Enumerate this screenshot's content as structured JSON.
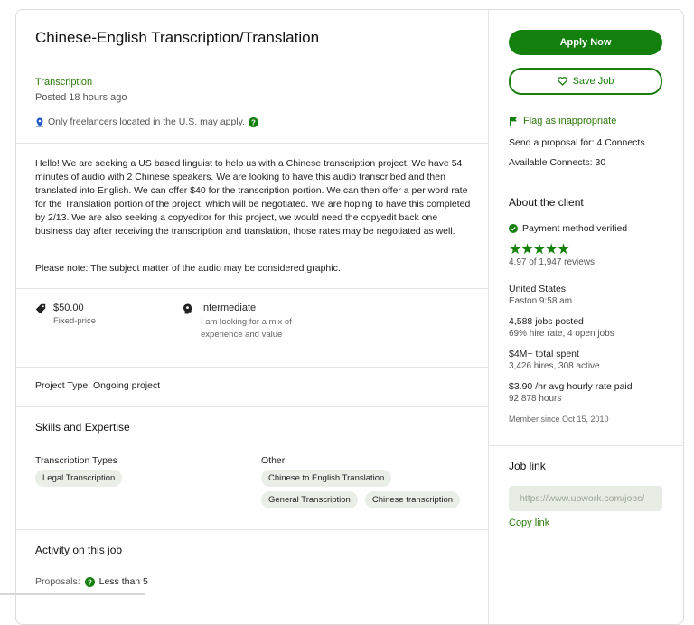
{
  "job": {
    "title": "Chinese-English Transcription/Translation",
    "category": "Transcription",
    "posted": "Posted 18 hours ago",
    "location_note": "Only freelancers located in the U.S. may apply.",
    "description": "Hello! We are seeking a US based linguist to help us with a Chinese transcription project. We have 54 minutes of audio with 2 Chinese speakers. We are looking to have this audio transcribed and then translated into English.  We can offer $40 for the transcription portion. We can then offer a per word rate for the Translation portion of the project, which will be negotiated. We are hoping to have this completed by 2/13.  We are also seeking a copyeditor for this project, we would need the copyedit back one business day after receiving the transcription and translation, those rates may be negotiated as well.",
    "note": "Please note: The subject matter of the audio may be considered graphic.",
    "price": "$50.00",
    "price_type": "Fixed-price",
    "level": "Intermediate",
    "level_desc_1": "I am looking for a mix of",
    "level_desc_2": "experience and value",
    "project_type_label": "Project Type:",
    "project_type": "Ongoing project"
  },
  "skills": {
    "heading": "Skills and Expertise",
    "group1_title": "Transcription Types",
    "group1": [
      "Legal Transcription"
    ],
    "group2_title": "Other",
    "group2": [
      "Chinese to English Translation",
      "General Transcription",
      "Chinese transcription"
    ]
  },
  "activity": {
    "heading": "Activity on this job",
    "proposals_label": "Proposals:",
    "proposals_value": "Less than 5"
  },
  "sidebar": {
    "apply_label": "Apply Now",
    "save_label": "Save Job",
    "flag_label": "Flag as inappropriate",
    "connects_send": "Send a proposal for: 4 Connects",
    "connects_available": "Available Connects: 30"
  },
  "client": {
    "heading": "About the client",
    "payment": "Payment method verified",
    "rating": 4.97,
    "stars": "★★★★★",
    "reviews": "4.97 of 1,947 reviews",
    "country": "United States",
    "local_time": "Easton 9:58 am",
    "jobs_posted": "4,588 jobs posted",
    "hire_rate": "69% hire rate, 4 open jobs",
    "spent": "$4M+ total spent",
    "hires": "3,426 hires, 308 active",
    "rate": "$3.90 /hr avg hourly rate paid",
    "hours": "92,878 hours",
    "member_since": "Member since Oct 15, 2010"
  },
  "joblink": {
    "heading": "Job link",
    "placeholder": "https://www.upwork.com/jobs/",
    "copy_label": "Copy link"
  },
  "colors": {
    "accent": "#137f0d",
    "chip": "#e9eee6"
  }
}
